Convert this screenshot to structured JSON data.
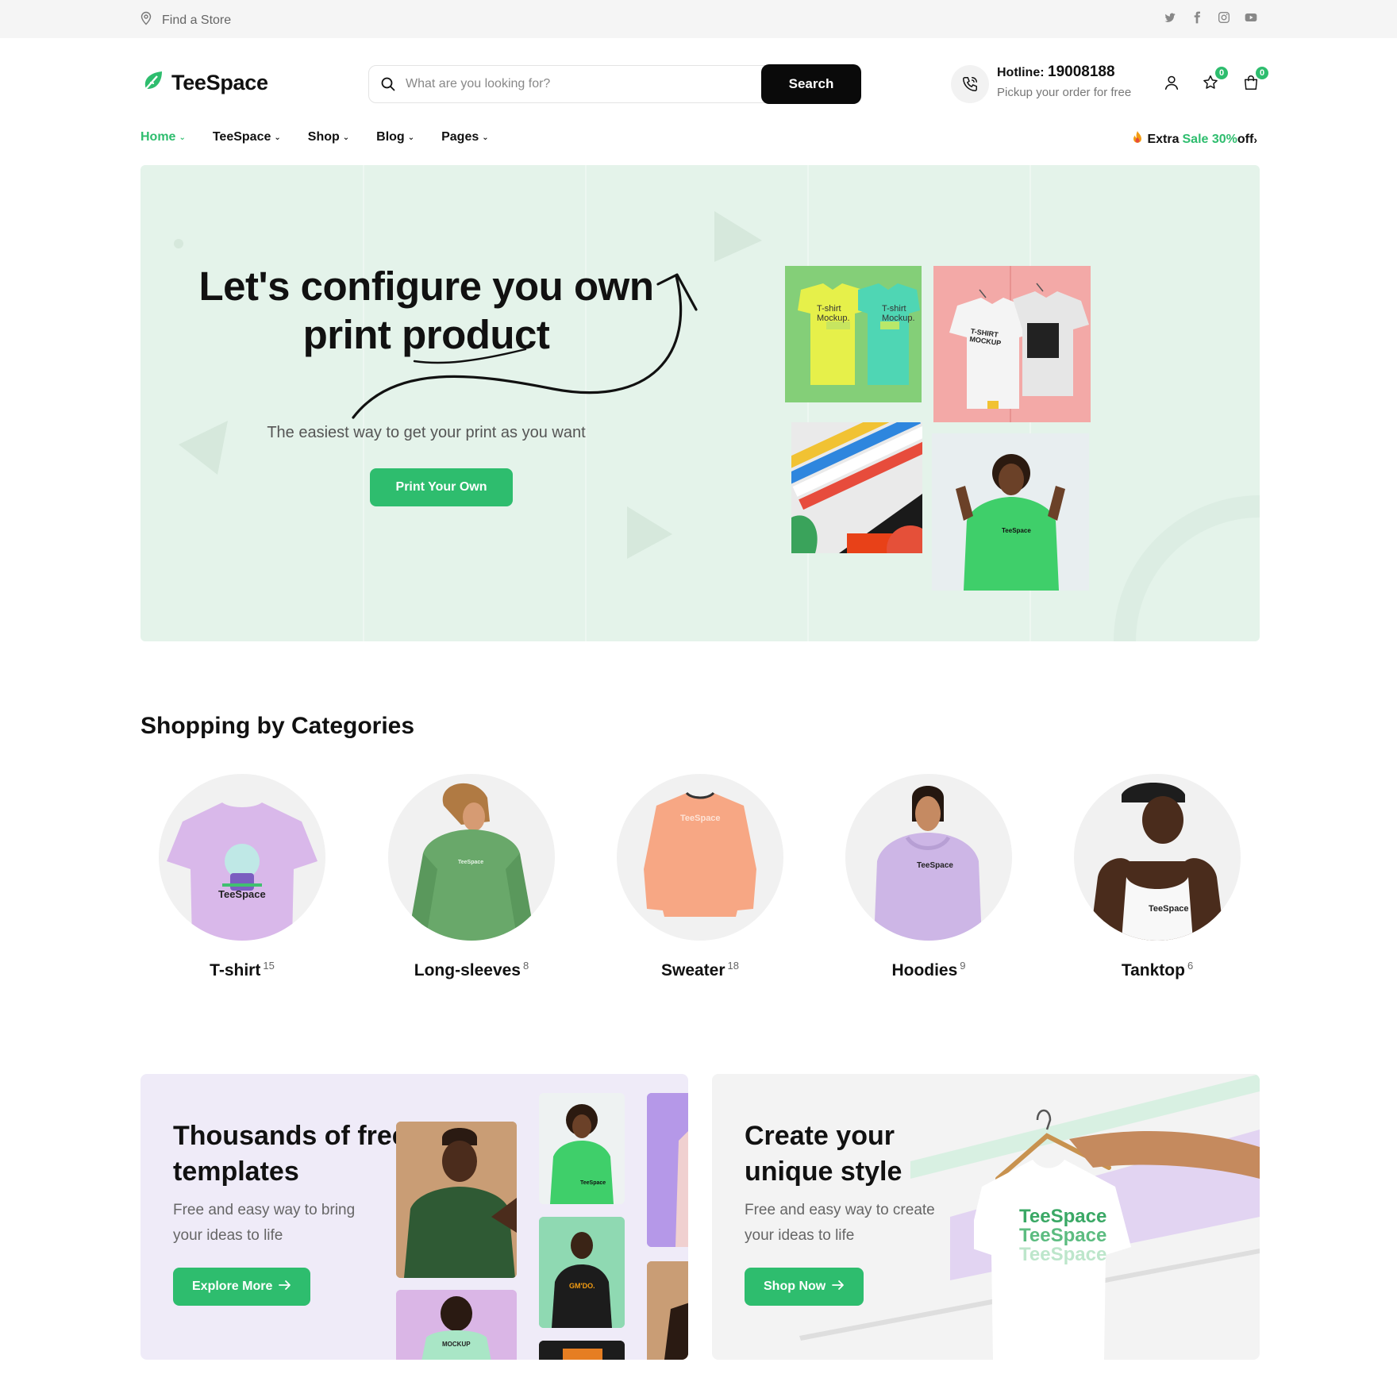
{
  "topbar": {
    "find_store": "Find a Store",
    "socials": [
      "twitter-icon",
      "facebook-icon",
      "instagram-icon",
      "youtube-icon"
    ]
  },
  "header": {
    "logo": "TeeSpace",
    "search": {
      "placeholder": "What are you looking for?",
      "button": "Search"
    },
    "hotline": {
      "label": "Hotline:",
      "number": "19008188",
      "sub": "Pickup your order for free"
    },
    "wishlist_count": "0",
    "cart_count": "0"
  },
  "nav": {
    "items": [
      {
        "label": "Home",
        "active": true
      },
      {
        "label": "TeeSpace"
      },
      {
        "label": "Shop"
      },
      {
        "label": "Blog"
      },
      {
        "label": "Pages"
      }
    ],
    "promo": {
      "prefix": "Extra",
      "highlight": "Sale 30%",
      "suffix": "off"
    }
  },
  "hero": {
    "title_line1": "Let's configure you own",
    "title_line2": "print product",
    "subtitle": "The easiest way to get your print as you want",
    "button": "Print Your Own",
    "images": {
      "tshirt_mockup_1": "T-shirt Mockup.",
      "tshirt_mockup_2": "T-shirt Mockup.",
      "hanger_mockup": "T-SHIRT MOCKUP",
      "hoodie_logo": "TeeSpace"
    }
  },
  "categories": {
    "title": "Shopping by Categories",
    "items": [
      {
        "name": "T-shirt",
        "count": "15",
        "print": "TeeSpace"
      },
      {
        "name": "Long-sleeves",
        "count": "8",
        "print": "TeeSpace"
      },
      {
        "name": "Sweater",
        "count": "18",
        "print": "TeeSpace"
      },
      {
        "name": "Hoodies",
        "count": "9",
        "print": "TeeSpace"
      },
      {
        "name": "Tanktop",
        "count": "6",
        "print": "TeeSpace"
      }
    ]
  },
  "banners": [
    {
      "title": "Thousands of free templates",
      "subtitle": "Free and easy way to bring your ideas to life",
      "button": "Explore More",
      "thumb_labels": {
        "hoodie": "TeeSpace",
        "mockup": "MOCKUP",
        "black_hoodie": "GM'DO."
      }
    },
    {
      "title": "Create your unique style",
      "subtitle": "Free and easy way to create your ideas to life",
      "button": "Shop Now",
      "shirt_print": [
        "TeeSpace",
        "TeeSpace",
        "TeeSpace"
      ]
    }
  ],
  "colors": {
    "accent": "#2ebd6e",
    "hero_bg": "#e4f3ea",
    "banner1_bg": "#efebf8",
    "banner2_bg": "#f3f3f3"
  }
}
